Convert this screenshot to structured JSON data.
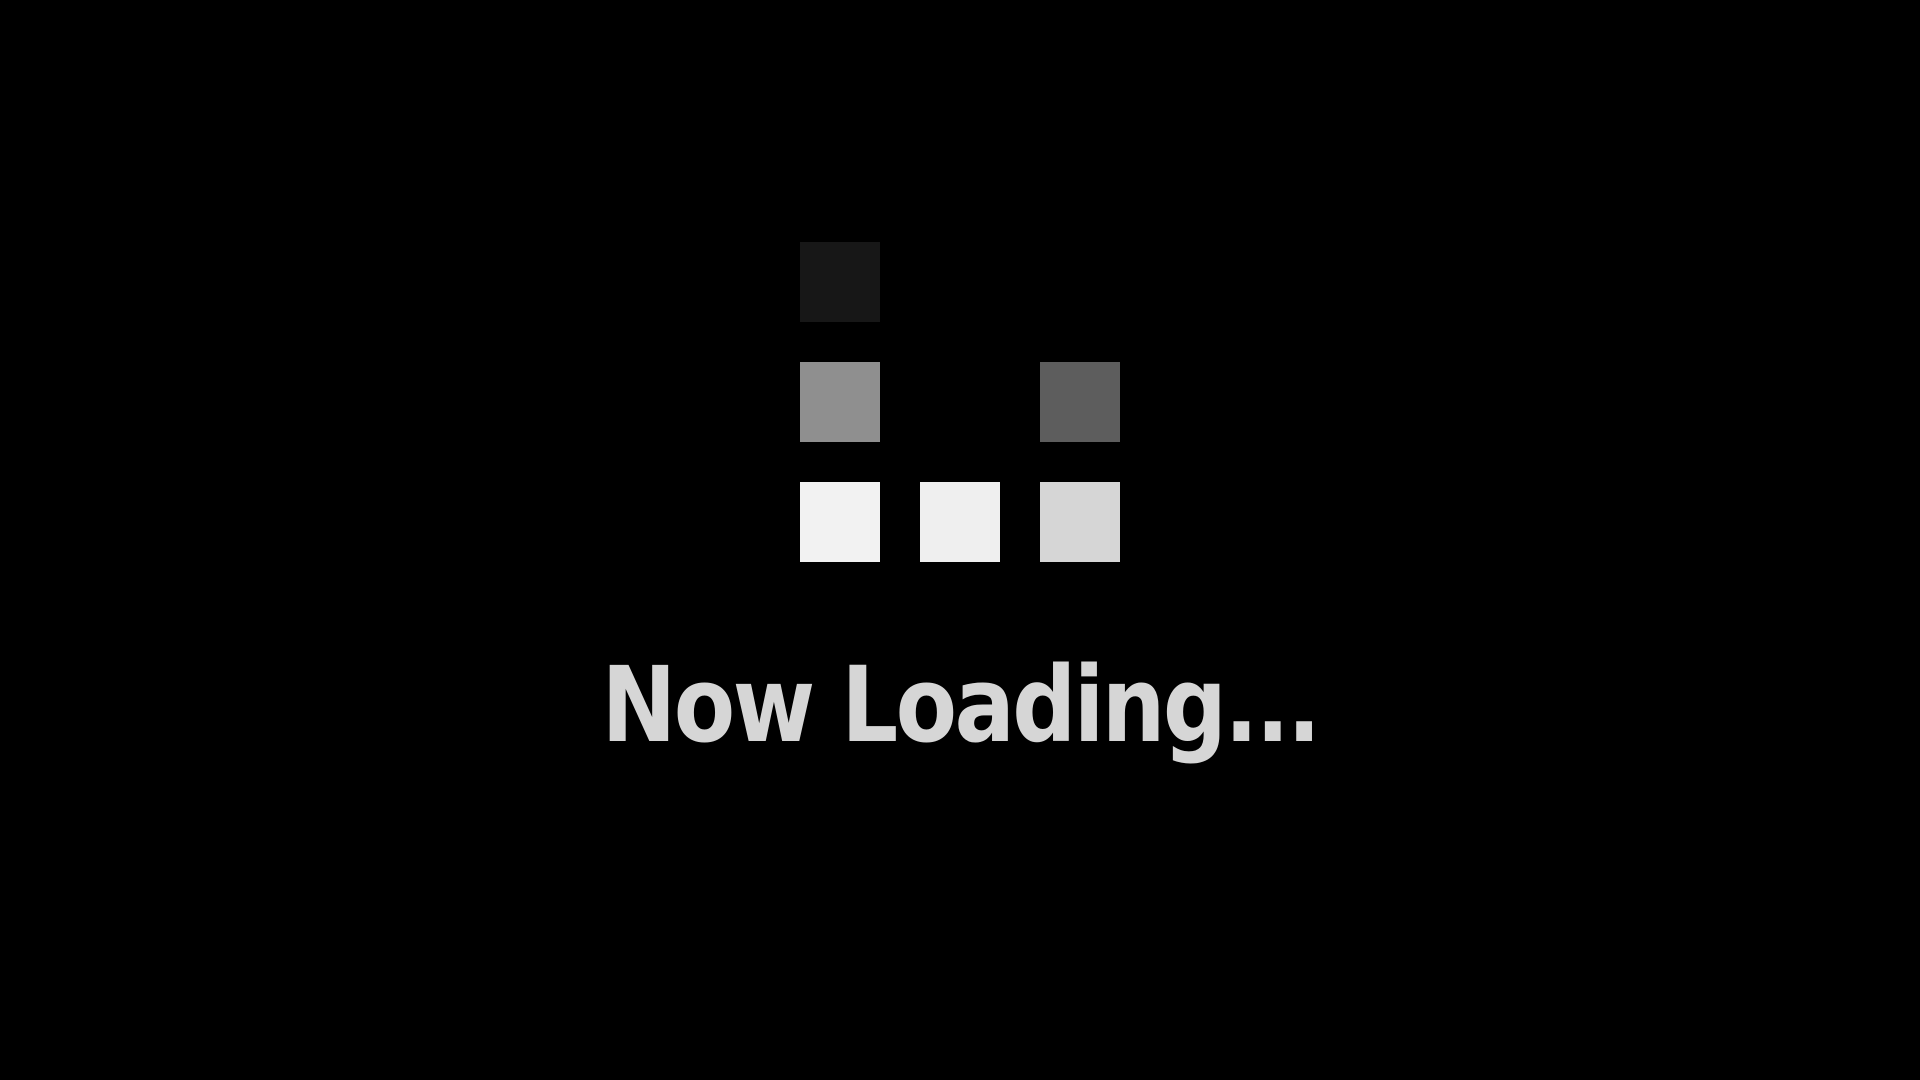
{
  "loading": {
    "text": "Now Loading..."
  },
  "spinner": {
    "icon": "block-loading-spinner-icon",
    "cells": [
      {
        "id": "top-left",
        "color": "#171717"
      },
      {
        "id": "middle-left",
        "color": "#8f8f8f"
      },
      {
        "id": "middle-right",
        "color": "#5d5d5d"
      },
      {
        "id": "bottom-left",
        "color": "#f2f2f2"
      },
      {
        "id": "bottom-center",
        "color": "#efefef"
      },
      {
        "id": "bottom-right",
        "color": "#d6d6d6"
      }
    ]
  },
  "colors": {
    "background": "#000000",
    "text": "#d6d6d6"
  }
}
